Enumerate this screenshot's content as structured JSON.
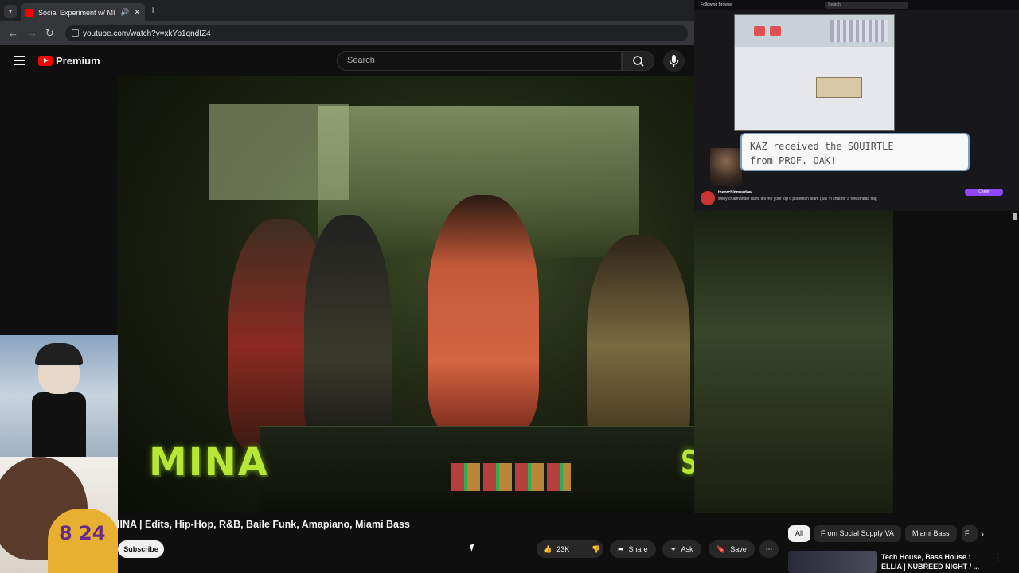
{
  "browser": {
    "tab_title": "Social Experiment w/ MINA",
    "url": "youtube.com/watch?v=xkYp1qndIZ4"
  },
  "youtube": {
    "brand": "Premium",
    "search_placeholder": "Search"
  },
  "video": {
    "overlay_left": "MINA",
    "overlay_right": "SOCIAL EXPERIMENT",
    "title": "IINA | Edits, Hip-Hop, R&B, Baile Funk, Amapiano, Miami Bass"
  },
  "actions": {
    "subscribe": "Subscribe",
    "likes": "23K",
    "share": "Share",
    "ask": "Ask",
    "save": "Save"
  },
  "chips": [
    "All",
    "From Social Supply VA",
    "Miami Bass",
    "F"
  ],
  "recommendation": {
    "title": "Tech House, Bass House : ELLIA | NUBREED NIGHT / ..."
  },
  "stream": {
    "top_left": "Following   Browse",
    "search": "Search",
    "dialog_line1": "KAZ received the SQUIRTLE",
    "dialog_line2": "from PROF. OAK!",
    "chat_name": "theorchidmeadow",
    "chat_msg": "shiny charmander hunt, tell me your top 6 pokemon team (say !n chat for a foresthead flag)",
    "cheer": "Cheer"
  },
  "facecam": {
    "jersey_number": "8 24"
  },
  "colors": {
    "accent": "#ff0000",
    "overlay_green": "#b8e634",
    "twitch_purple": "#9147ff"
  }
}
